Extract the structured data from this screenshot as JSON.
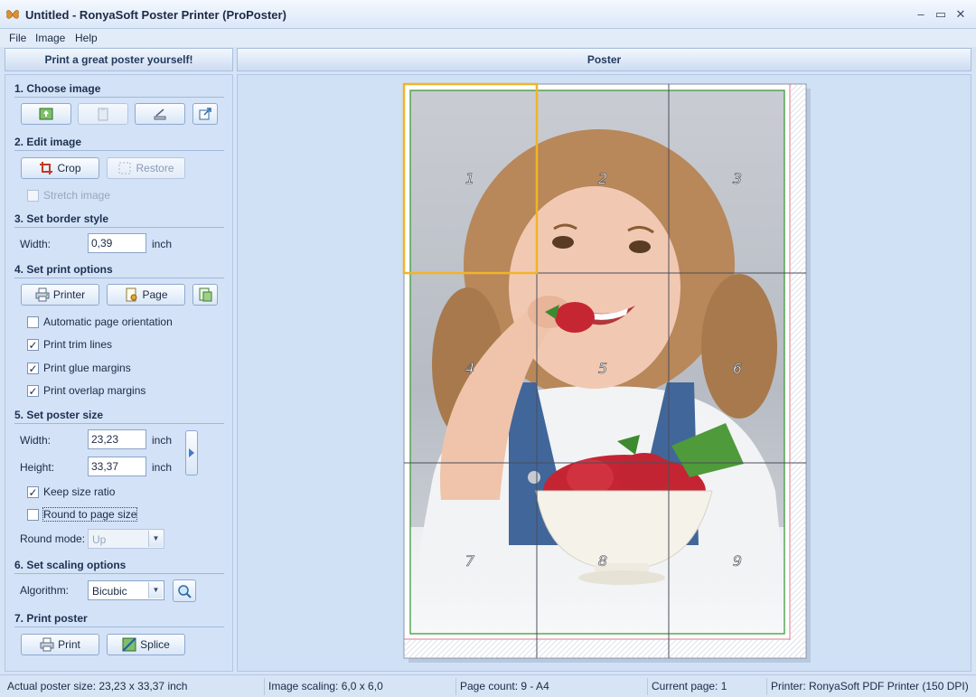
{
  "window": {
    "title": "Untitled - RonyaSoft Poster Printer (ProPoster)"
  },
  "menu": [
    "File",
    "Image",
    "Help"
  ],
  "headers": {
    "left": "Print a great poster yourself!",
    "right": "Poster"
  },
  "sections": {
    "choose_image": "1. Choose image",
    "edit_image": "2. Edit image",
    "border_style": "3. Set border style",
    "print_options": "4. Set print options",
    "poster_size": "5. Set poster size",
    "scaling": "6. Set scaling options",
    "print_poster": "7. Print poster"
  },
  "edit": {
    "crop": "Crop",
    "restore": "Restore",
    "stretch": "Stretch image",
    "stretch_checked": false
  },
  "border": {
    "width_label": "Width:",
    "width_value": "0,39",
    "unit": "inch"
  },
  "print_options": {
    "printer": "Printer",
    "page": "Page",
    "checks": [
      {
        "label": "Automatic page orientation",
        "checked": false
      },
      {
        "label": "Print trim lines",
        "checked": true
      },
      {
        "label": "Print glue margins",
        "checked": true
      },
      {
        "label": "Print overlap margins",
        "checked": true
      }
    ]
  },
  "poster_size": {
    "width_label": "Width:",
    "width_value": "23,23",
    "height_label": "Height:",
    "height_value": "33,37",
    "unit": "inch",
    "keep_ratio": "Keep size ratio",
    "keep_ratio_checked": true,
    "round_page": "Round to page size",
    "round_page_checked": false,
    "round_mode_label": "Round mode:",
    "round_mode_value": "Up"
  },
  "scaling": {
    "algorithm_label": "Algorithm:",
    "algorithm_value": "Bicubic"
  },
  "print": {
    "print": "Print",
    "splice": "Splice"
  },
  "poster": {
    "tiles": [
      "1",
      "2",
      "3",
      "4",
      "5",
      "6",
      "7",
      "8",
      "9"
    ],
    "selected_tile": "1"
  },
  "status": {
    "size": "Actual poster size: 23,23 x 33,37 inch",
    "scaling": "Image scaling: 6,0 x 6,0",
    "pages": "Page count: 9 - A4",
    "current": "Current page: 1",
    "printer": "Printer: RonyaSoft PDF Printer (150 DPI)"
  },
  "colors": {
    "selection": "#f0b429",
    "border_green": "#3f9a3c",
    "glue_red": "#d87a8e",
    "panel_bg": "#d3e2f6"
  }
}
